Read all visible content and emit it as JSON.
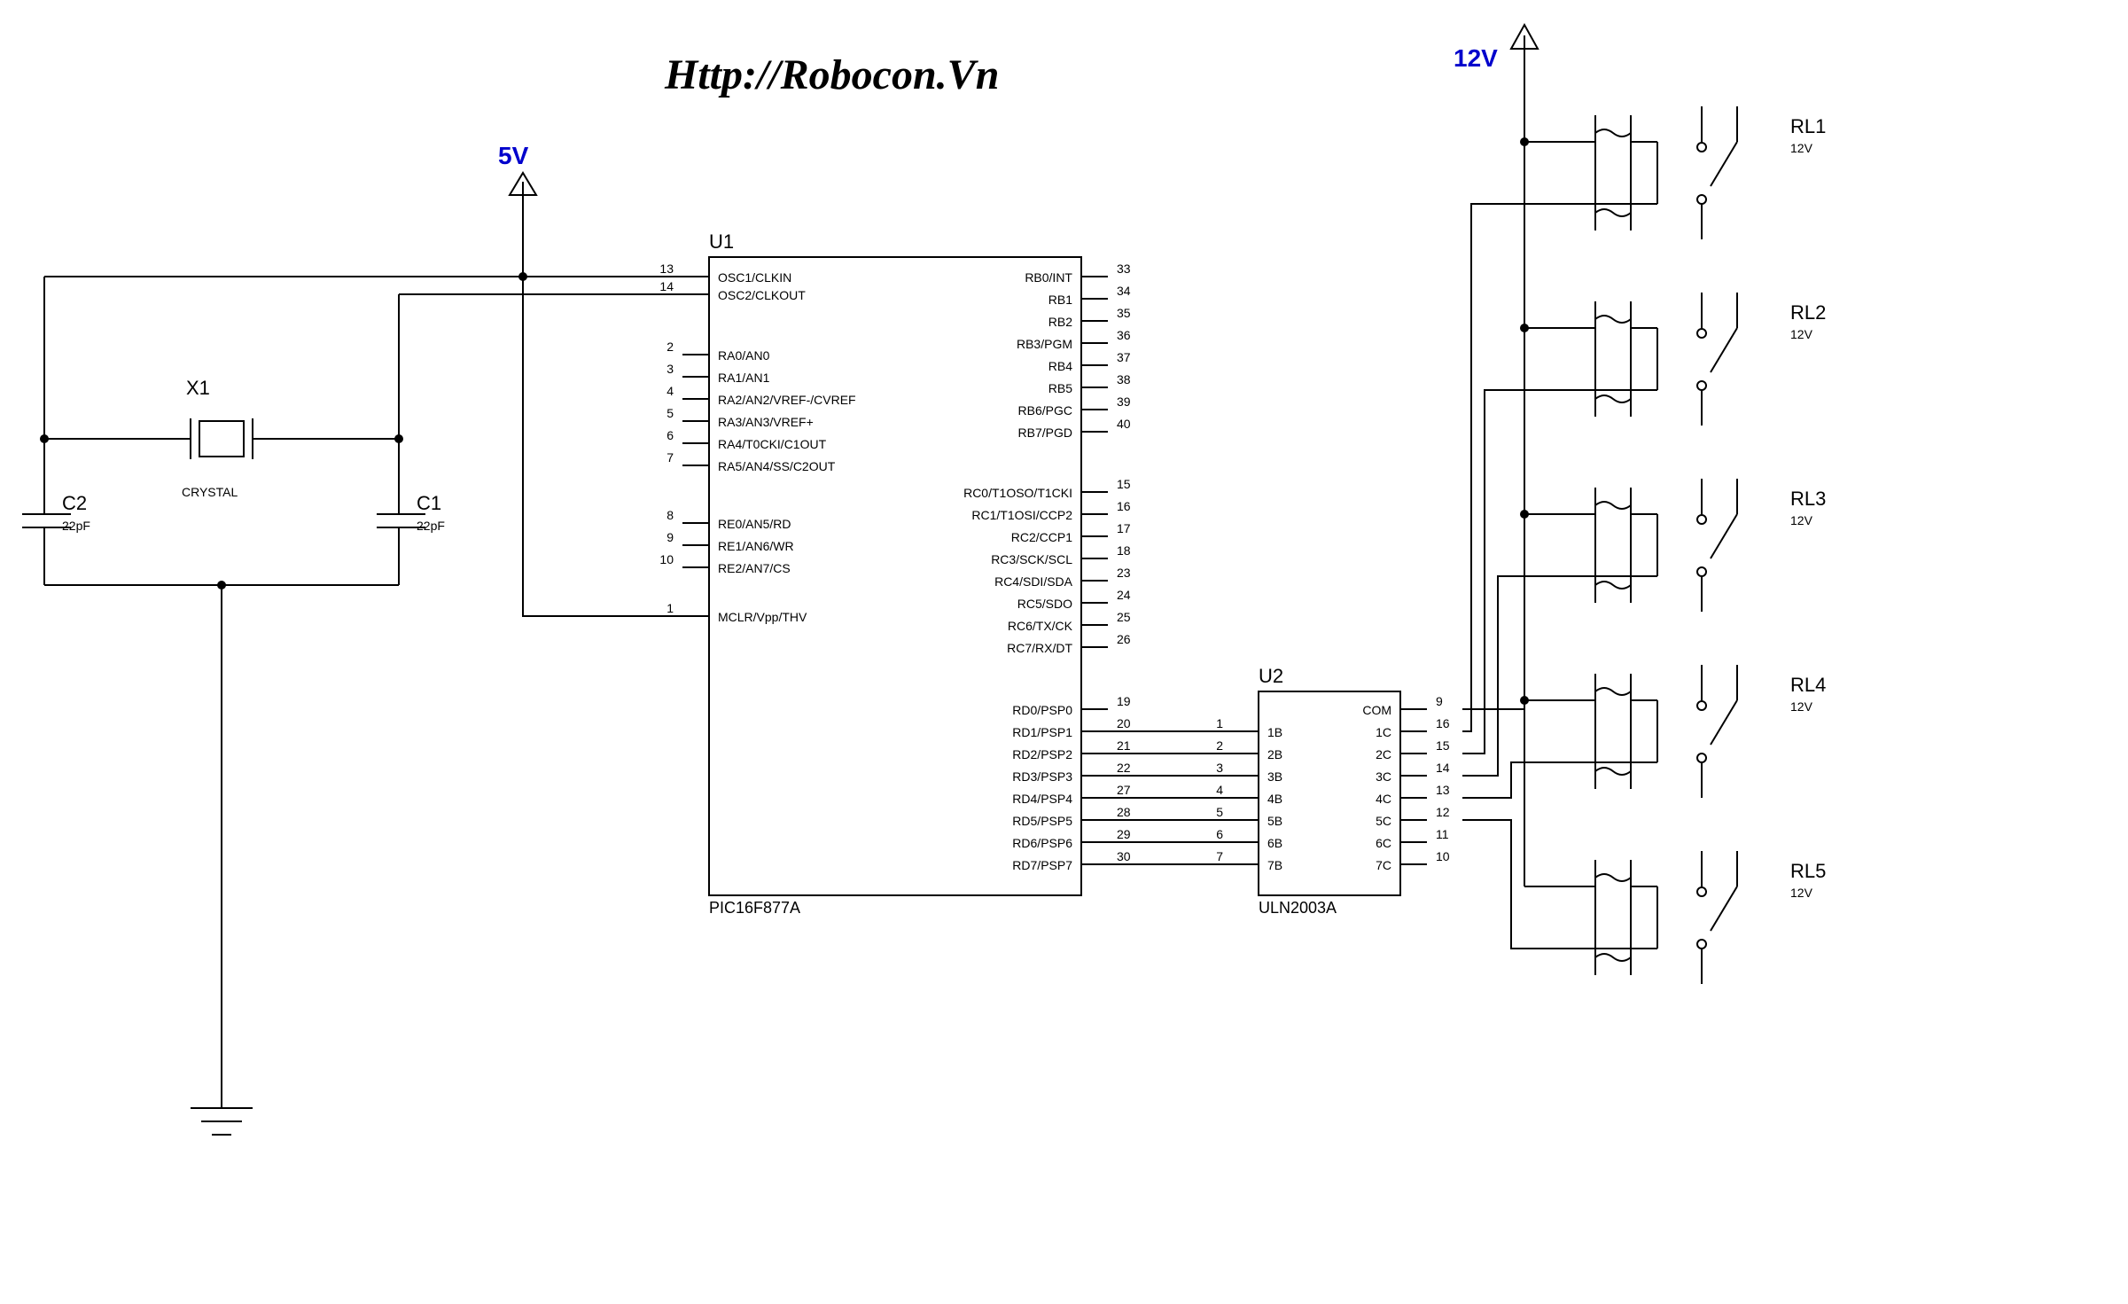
{
  "title_url": "Http://Robocon.Vn",
  "power": {
    "v5": "5V",
    "v12": "12V"
  },
  "crystal": {
    "ref": "X1",
    "sub": "CRYSTAL"
  },
  "caps": {
    "c1": {
      "ref": "C1",
      "val": "22pF"
    },
    "c2": {
      "ref": "C2",
      "val": "22pF"
    }
  },
  "u1": {
    "ref": "U1",
    "part": "PIC16F877A",
    "left_pins": [
      {
        "num": "13",
        "name": "OSC1/CLKIN"
      },
      {
        "num": "14",
        "name": "OSC2/CLKOUT"
      },
      {
        "num": "2",
        "name": "RA0/AN0"
      },
      {
        "num": "3",
        "name": "RA1/AN1"
      },
      {
        "num": "4",
        "name": "RA2/AN2/VREF-/CVREF"
      },
      {
        "num": "5",
        "name": "RA3/AN3/VREF+"
      },
      {
        "num": "6",
        "name": "RA4/T0CKI/C1OUT"
      },
      {
        "num": "7",
        "name": "RA5/AN4/SS/C2OUT"
      },
      {
        "num": "8",
        "name": "RE0/AN5/RD"
      },
      {
        "num": "9",
        "name": "RE1/AN6/WR"
      },
      {
        "num": "10",
        "name": "RE2/AN7/CS"
      },
      {
        "num": "1",
        "name": "MCLR/Vpp/THV"
      }
    ],
    "right_pins": [
      {
        "num": "33",
        "name": "RB0/INT"
      },
      {
        "num": "34",
        "name": "RB1"
      },
      {
        "num": "35",
        "name": "RB2"
      },
      {
        "num": "36",
        "name": "RB3/PGM"
      },
      {
        "num": "37",
        "name": "RB4"
      },
      {
        "num": "38",
        "name": "RB5"
      },
      {
        "num": "39",
        "name": "RB6/PGC"
      },
      {
        "num": "40",
        "name": "RB7/PGD"
      },
      {
        "num": "15",
        "name": "RC0/T1OSO/T1CKI"
      },
      {
        "num": "16",
        "name": "RC1/T1OSI/CCP2"
      },
      {
        "num": "17",
        "name": "RC2/CCP1"
      },
      {
        "num": "18",
        "name": "RC3/SCK/SCL"
      },
      {
        "num": "23",
        "name": "RC4/SDI/SDA"
      },
      {
        "num": "24",
        "name": "RC5/SDO"
      },
      {
        "num": "25",
        "name": "RC6/TX/CK"
      },
      {
        "num": "26",
        "name": "RC7/RX/DT"
      },
      {
        "num": "19",
        "name": "RD0/PSP0"
      },
      {
        "num": "20",
        "name": "RD1/PSP1"
      },
      {
        "num": "21",
        "name": "RD2/PSP2"
      },
      {
        "num": "22",
        "name": "RD3/PSP3"
      },
      {
        "num": "27",
        "name": "RD4/PSP4"
      },
      {
        "num": "28",
        "name": "RD5/PSP5"
      },
      {
        "num": "29",
        "name": "RD6/PSP6"
      },
      {
        "num": "30",
        "name": "RD7/PSP7"
      }
    ]
  },
  "u2": {
    "ref": "U2",
    "part": "ULN2003A",
    "left_pins": [
      {
        "num": "1",
        "name": "1B"
      },
      {
        "num": "2",
        "name": "2B"
      },
      {
        "num": "3",
        "name": "3B"
      },
      {
        "num": "4",
        "name": "4B"
      },
      {
        "num": "5",
        "name": "5B"
      },
      {
        "num": "6",
        "name": "6B"
      },
      {
        "num": "7",
        "name": "7B"
      }
    ],
    "right_pins": [
      {
        "num": "9",
        "name": "COM"
      },
      {
        "num": "16",
        "name": "1C"
      },
      {
        "num": "15",
        "name": "2C"
      },
      {
        "num": "14",
        "name": "3C"
      },
      {
        "num": "13",
        "name": "4C"
      },
      {
        "num": "12",
        "name": "5C"
      },
      {
        "num": "11",
        "name": "6C"
      },
      {
        "num": "10",
        "name": "7C"
      }
    ]
  },
  "relays": [
    {
      "ref": "RL1",
      "val": "12V"
    },
    {
      "ref": "RL2",
      "val": "12V"
    },
    {
      "ref": "RL3",
      "val": "12V"
    },
    {
      "ref": "RL4",
      "val": "12V"
    },
    {
      "ref": "RL5",
      "val": "12V"
    }
  ]
}
